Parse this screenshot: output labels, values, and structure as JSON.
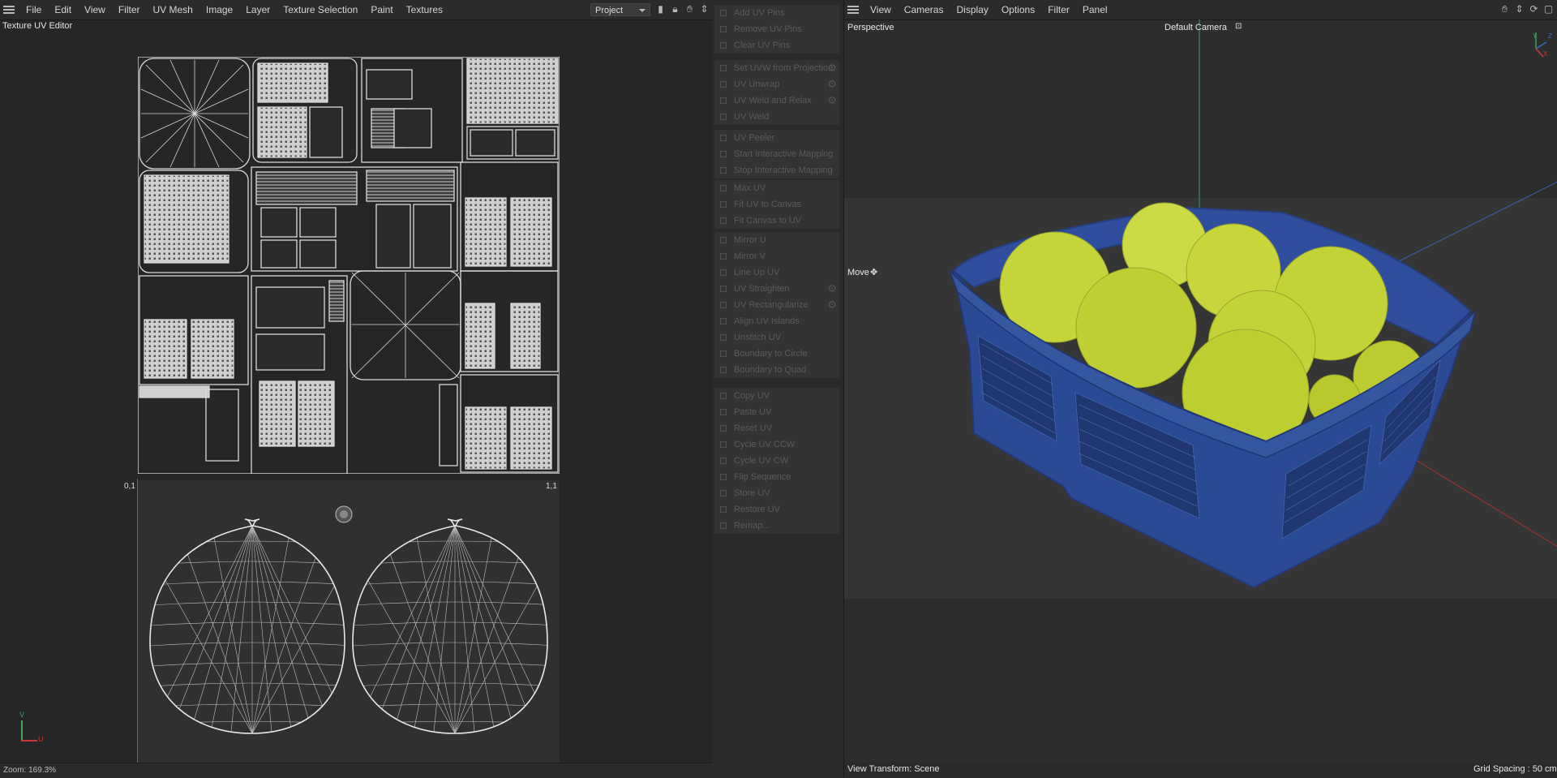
{
  "uv_editor": {
    "menu": [
      "File",
      "Edit",
      "View",
      "Filter",
      "UV Mesh",
      "Image",
      "Layer",
      "Texture Selection",
      "Paint",
      "Textures"
    ],
    "project_select": "Project",
    "title": "Texture UV Editor",
    "corner_left": "0,1",
    "corner_right": "1,1",
    "axis_v": "V",
    "axis_u": "U",
    "zoom": "Zoom: 169.3%"
  },
  "commands": {
    "groups": [
      [
        "Add UV Pins",
        "Remove UV Pins",
        "Clear UV Pins"
      ],
      [
        "Set UVW from Projection",
        "UV Unwrap",
        "UV Weld and Relax",
        "UV Weld"
      ],
      [
        "UV Peeler",
        "Start Interactive Mapping",
        "Stop Interactive Mapping"
      ],
      [
        "Max UV",
        "Fit UV to Canvas",
        "Fit Canvas to UV"
      ],
      [
        "Mirror U",
        "Mirror V",
        "Line Up UV",
        "UV Straighten",
        "UV Rectangularize",
        "Align UV Islands",
        "Unstitch UV",
        "Boundary to Circle",
        "Boundary to Quad"
      ],
      [
        "Copy UV",
        "Paste UV",
        "Reset UV",
        "Cycle UV CCW",
        "Cycle UV CW",
        "Flip Sequence",
        "Store UV",
        "Restore UV",
        "Remap..."
      ]
    ],
    "gear_items": [
      "Set UVW from Projection",
      "UV Unwrap",
      "UV Weld and Relax",
      "UV Straighten",
      "UV Rectangularize"
    ]
  },
  "viewport": {
    "menu": [
      "View",
      "Cameras",
      "Display",
      "Options",
      "Filter",
      "Panel"
    ],
    "projection": "Perspective",
    "camera": "Default Camera",
    "tool": "Move",
    "axis_y": "Y",
    "axis_z": "Z",
    "axis_x": "X",
    "view_transform": "View Transform: Scene",
    "grid_spacing": "Grid Spacing : 50 cm"
  },
  "colors": {
    "accent_green": "#2e8b57",
    "crate_blue": "#2f4f9e",
    "fruit": "#c7d636",
    "wire": "#d9d9d9"
  }
}
